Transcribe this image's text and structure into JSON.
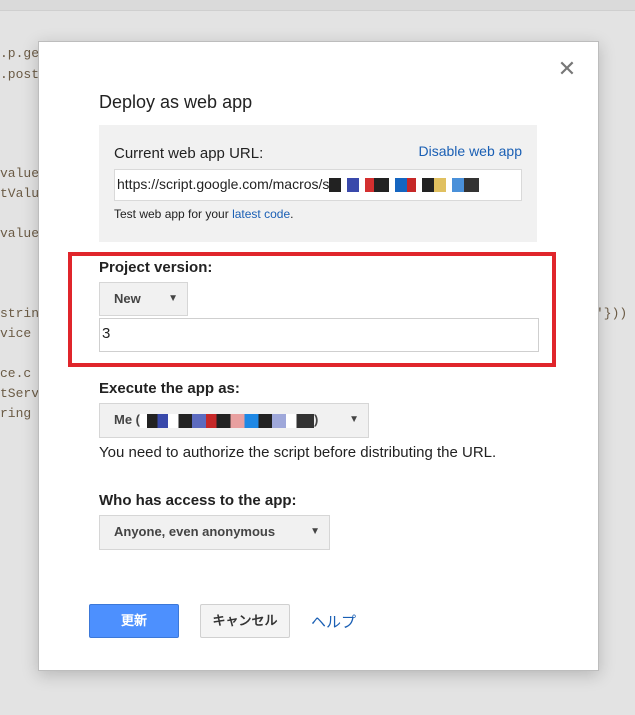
{
  "background_code": {
    "lines": [
      ".p.get",
      ".post",
      "value",
      "tValu",
      "value",
      "strin",
      "vice",
      "ce.c",
      "tServ",
      "ring",
      "'}))"
    ]
  },
  "dialog": {
    "title": "Deploy as web app",
    "close_icon": "close-icon",
    "url_section": {
      "label": "Current web app URL:",
      "disable_link": "Disable web app",
      "url_value": "https://script.google.com/macros/s",
      "test_prefix": "Test web app for your",
      "test_link": "latest code",
      "test_suffix": "."
    },
    "project_version": {
      "label": "Project version:",
      "selected": "New",
      "input_value": "3"
    },
    "execute_as": {
      "label": "Execute the app as:",
      "selected_prefix": "Me (",
      "selected_suffix": ")",
      "note": "You need to authorize the script before distributing the URL."
    },
    "access": {
      "label": "Who has access to the app:",
      "selected": "Anyone, even anonymous"
    },
    "buttons": {
      "update": "更新",
      "cancel": "キャンセル",
      "help": "ヘルプ"
    }
  },
  "colors": {
    "primary_button": "#4d90fe",
    "link": "#1a5fb4",
    "highlight_border": "#e0252b"
  }
}
